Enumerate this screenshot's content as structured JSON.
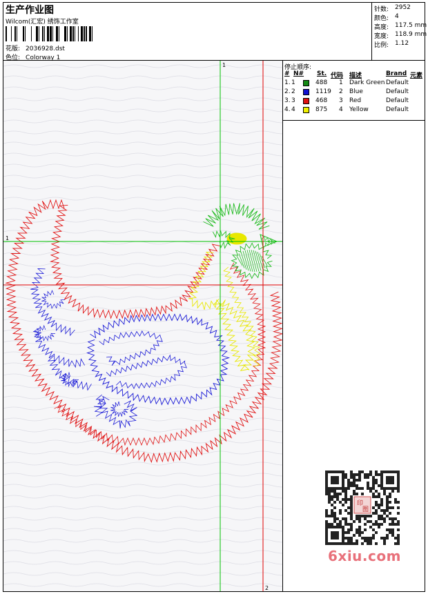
{
  "header": {
    "title": "生产作业图",
    "subtitle": "Wilcom(汇宏) 绣饰工作室",
    "design_label": "花版:",
    "design_value": "2036928.dst",
    "colorway_label": "色位:",
    "colorway_value": "Colorway 1"
  },
  "stats": [
    {
      "label": "针数:",
      "value": "2952"
    },
    {
      "label": "颜色:",
      "value": "4"
    },
    {
      "label": "高度:",
      "value": "117.5 mm"
    },
    {
      "label": "宽度:",
      "value": "118.9 mm"
    },
    {
      "label": "比例:",
      "value": "1.12"
    }
  ],
  "legend": {
    "title": "停止顺序:",
    "columns": [
      "#",
      "N#",
      "St.",
      "代码",
      "描述",
      "Brand",
      "元素"
    ],
    "rows": [
      {
        "idx": "1.",
        "n": "1",
        "color": "#138a13",
        "st": "488",
        "code": "1",
        "desc": "Dark Green",
        "brand": "Default"
      },
      {
        "idx": "2.",
        "n": "2",
        "color": "#1010d0",
        "st": "1119",
        "code": "2",
        "desc": "Blue",
        "brand": "Default"
      },
      {
        "idx": "3.",
        "n": "3",
        "color": "#e01010",
        "st": "468",
        "code": "3",
        "desc": "Red",
        "brand": "Default"
      },
      {
        "idx": "4.",
        "n": "4",
        "color": "#f0f000",
        "st": "875",
        "code": "4",
        "desc": "Yellow",
        "brand": "Default"
      }
    ]
  },
  "guides": {
    "green_label_1": "1",
    "green_label_2": "1",
    "red_label_2": "2"
  },
  "colors": {
    "green": "#22bb22",
    "blue": "#1a1ad6",
    "red": "#e01414",
    "yellow": "#e8e800",
    "guide_green": "#00c000",
    "guide_red": "#e00000"
  },
  "watermark": "6xiu.com",
  "qr_seal": [
    "印",
    "图"
  ]
}
